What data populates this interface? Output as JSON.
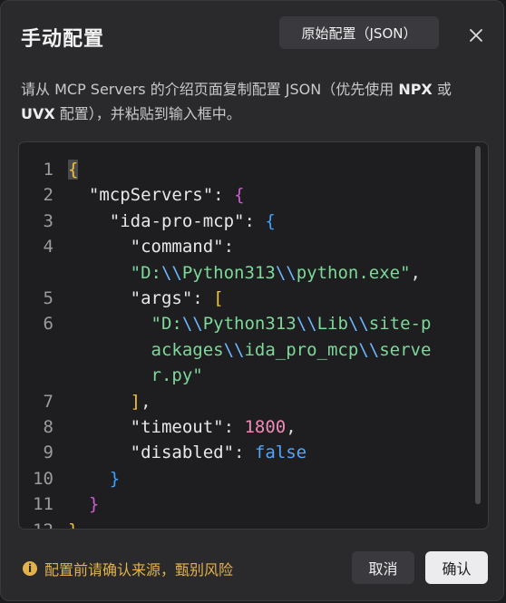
{
  "dialog": {
    "title": "手动配置",
    "raw_button": "原始配置（JSON）",
    "close_icon": "close-icon",
    "description": {
      "part1": "请从 MCP Servers 的介绍页面复制配置 JSON（优先使用 ",
      "npx": "NPX",
      "part2": " 或 ",
      "uvx": "UVX",
      "part3": " 配置），并粘贴到输入框中。"
    },
    "footer_note": "配置前请确认来源，甄别风险",
    "cancel_label": "取消",
    "confirm_label": "确认"
  },
  "editor": {
    "line_numbers": [
      "1",
      "2",
      "3",
      "4",
      "",
      "5",
      "6",
      "",
      "",
      "7",
      "8",
      "9",
      "10",
      "11",
      "12"
    ],
    "lines": {
      "l1": "{",
      "l2_key": "\"mcpServers\"",
      "l2_colon": ": ",
      "l2_brace": "{",
      "l3_key": "\"ida-pro-mcp\"",
      "l3_colon": ": ",
      "l3_brace": "{",
      "l4_key": "\"command\"",
      "l4_colon": ":",
      "l4b_s1": "\"D:",
      "l4b_e1": "\\\\",
      "l4b_s2": "Python313",
      "l4b_e2": "\\\\",
      "l4b_s3": "python.exe\"",
      "l4b_comma": ",",
      "l5_key": "\"args\"",
      "l5_colon": ": ",
      "l5_bracket": "[",
      "l6_s1": "\"D:",
      "l6_e1": "\\\\",
      "l6_s2": "Python313",
      "l6_e2": "\\\\",
      "l6_s3": "Lib",
      "l6_e3": "\\\\",
      "l6_s4": "site-p",
      "l6b_s1": "ackages",
      "l6b_e1": "\\\\",
      "l6b_s2": "ida_pro_mcp",
      "l6b_e2": "\\\\",
      "l6b_s3": "serve",
      "l6c_s1": "r.py\"",
      "l7_bracket": "]",
      "l7_comma": ",",
      "l8_key": "\"timeout\"",
      "l8_colon": ": ",
      "l8_val": "1800",
      "l8_comma": ",",
      "l9_key": "\"disabled\"",
      "l9_colon": ": ",
      "l9_val": "false",
      "l10": "}",
      "l11": "}",
      "l12": "}"
    }
  }
}
